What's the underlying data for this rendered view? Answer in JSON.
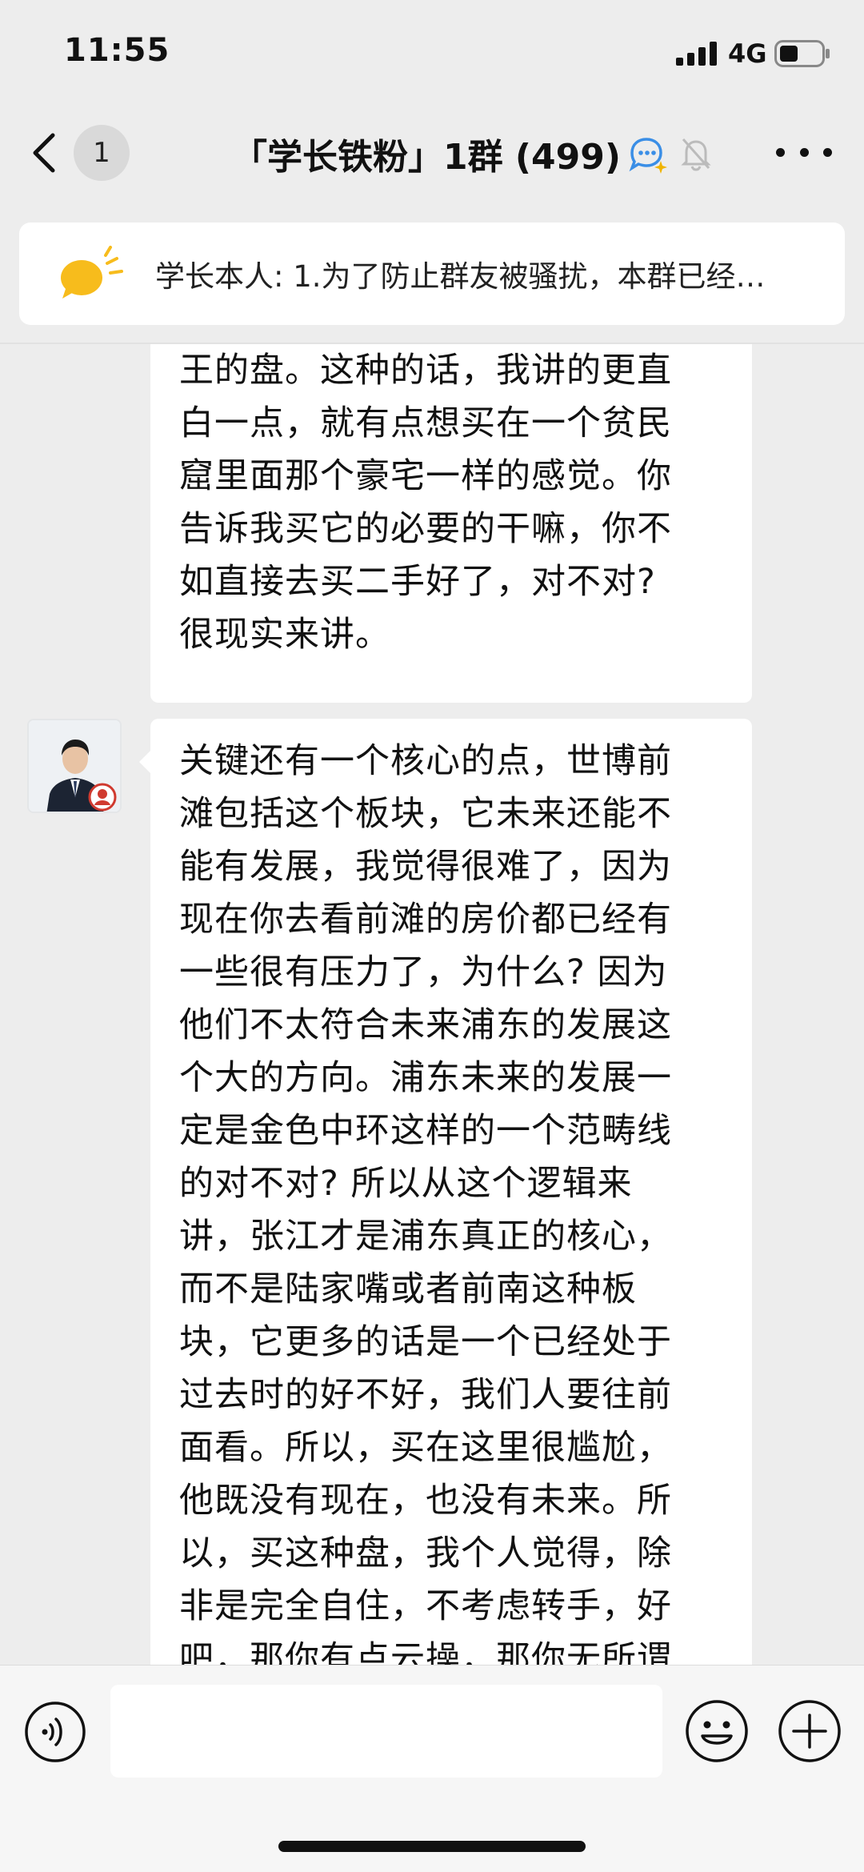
{
  "status_bar": {
    "time": "11:55",
    "network": "4G",
    "signal_icon": "signal-bars-icon",
    "battery_icon": "battery-icon"
  },
  "header": {
    "back_icon": "chevron-left-icon",
    "unread_count": "1",
    "title": "「学长铁粉」1群 (499)",
    "ai_icon": "chat-bubble-sparkle-icon",
    "mute_icon": "bell-muted-icon",
    "more_icon": "more-dots-icon"
  },
  "announcement": {
    "icon": "megaphone-icon",
    "text": "学长本人: 1.为了防止群友被骚扰，本群已经…"
  },
  "messages": [
    {
      "lines": [
        "王的盘。这种的话，我讲的更直",
        "白一点，就有点想买在一个贫民",
        "窟里面那个豪宅一样的感觉。你",
        "告诉我买它的必要的干嘛，你不",
        "如直接去买二手好了，对不对?",
        "很现实来讲。"
      ]
    },
    {
      "lines": [
        "关键还有一个核心的点，世博前",
        "滩包括这个板块，它未来还能不",
        "能有发展，我觉得很难了，因为",
        "现在你去看前滩的房价都已经有",
        "一些很有压力了，为什么? 因为",
        "他们不太符合未来浦东的发展这",
        "个大的方向。浦东未来的发展一",
        "定是金色中环这样的一个范畴线",
        "的对不对? 所以从这个逻辑来",
        "讲，张江才是浦东真正的核心，",
        "而不是陆家嘴或者前南这种板",
        "块，它更多的话是一个已经处于",
        "过去时的好不好，我们人要往前",
        "面看。所以，买在这里很尴尬，",
        "他既没有现在，也没有未来。所",
        "以，买这种盘，我个人觉得，除",
        "非是完全自住，不考虑转手，好",
        "吧，那你有点云操，那你无所谓"
      ]
    }
  ],
  "input_bar": {
    "voice_icon": "voice-icon",
    "emoji_icon": "emoji-icon",
    "add_icon": "plus-circle-icon"
  }
}
